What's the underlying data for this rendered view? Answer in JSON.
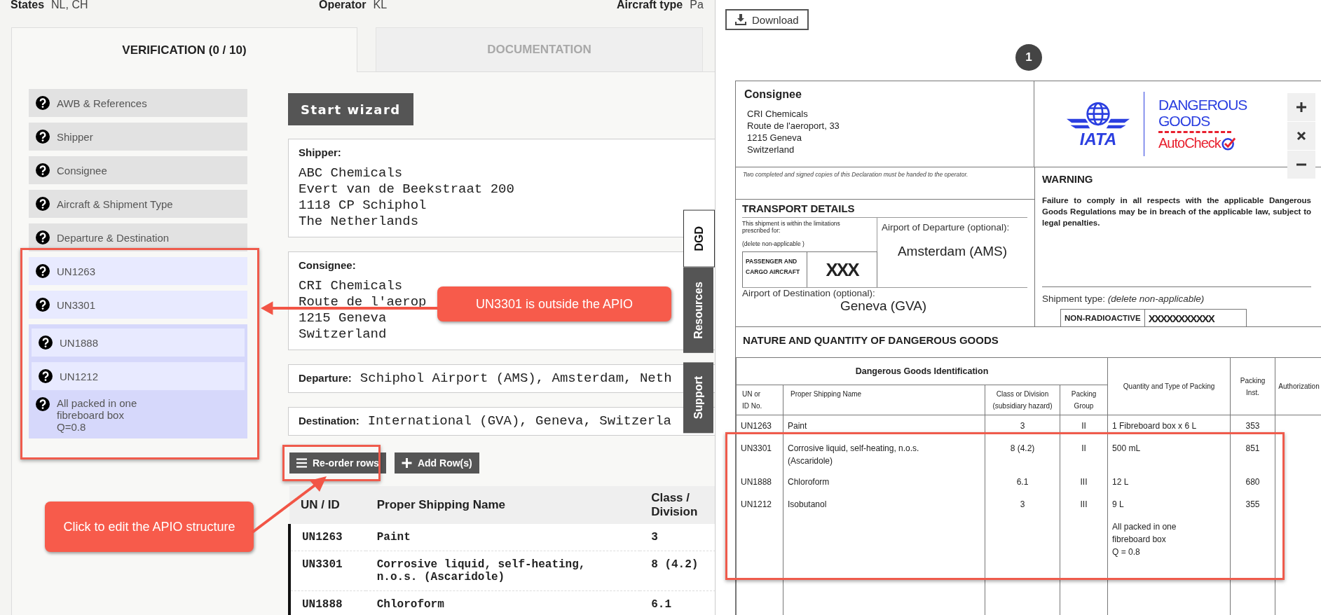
{
  "info_bar": [
    {
      "label": "States",
      "value": "NL, CH"
    },
    {
      "label": "Operator",
      "value": "KL"
    },
    {
      "label": "Aircraft type",
      "value": "Pa"
    }
  ],
  "tabs": [
    {
      "label": "VERIFICATION (0 / 10)",
      "selected": true
    },
    {
      "label": "DOCUMENTATION",
      "selected": false
    }
  ],
  "sidebar": {
    "items": [
      {
        "label": "AWB & References",
        "kind": "section"
      },
      {
        "label": "Shipper",
        "kind": "section"
      },
      {
        "label": "Consignee",
        "kind": "section"
      },
      {
        "label": "Aircraft & Shipment Type",
        "kind": "section"
      },
      {
        "label": "Departure & Destination",
        "kind": "section"
      },
      {
        "label": "UN1263",
        "kind": "apio"
      },
      {
        "label": "UN3301",
        "kind": "apio"
      },
      {
        "label": "All packed in one\nfibreboard box\nQ=0.8",
        "kind": "group",
        "children": [
          {
            "label": "UN1888",
            "kind": "apio"
          },
          {
            "label": "UN1212",
            "kind": "apio"
          }
        ]
      }
    ]
  },
  "wizard_button": "Start wizard",
  "shipper": {
    "label": "Shipper:",
    "lines": [
      "ABC Chemicals",
      "Evert van de Beekstraat 200",
      "1118 CP Schiphol",
      "The Netherlands"
    ]
  },
  "consignee": {
    "label": "Consignee:",
    "lines": [
      "CRI Chemicals",
      "Route de l'aerop",
      "1215 Geneva",
      "Switzerland"
    ]
  },
  "departure": {
    "label": "Departure:",
    "value": "Schiphol Airport (AMS), Amsterdam, Neth"
  },
  "destination": {
    "label": "Destination:",
    "value": "International (GVA), Geneva, Switzerla"
  },
  "row_buttons": [
    {
      "label": "Re-order rows",
      "kind": "reorder"
    },
    {
      "label": "Add Row(s)",
      "kind": "add"
    }
  ],
  "table": {
    "columns": [
      "UN / ID",
      "Proper Shipping Name",
      "Class /\nDivision"
    ],
    "rows": [
      [
        "UN1263",
        "Paint",
        "3"
      ],
      [
        "UN3301",
        "Corrosive liquid, self-heating,\nn.o.s. (Ascaridole)",
        "8 (4.2)"
      ],
      [
        "UN1888",
        "Chloroform",
        "6.1"
      ]
    ]
  },
  "side_tabs": [
    {
      "label": "DGD",
      "selected": true
    },
    {
      "label": "Resources",
      "selected": false
    },
    {
      "label": "Support",
      "selected": false
    }
  ],
  "callouts": [
    "UN3301 is outside the APIO",
    "Click to edit the APIO structure"
  ],
  "document": {
    "download_button": "Download",
    "page_number": "1",
    "consignee": {
      "title": "Consignee",
      "lines": [
        "CRI Chemicals",
        "Route de l'aeroport, 33",
        "1215 Geneva",
        "Switzerland"
      ]
    },
    "logo": {
      "mark": "IATA",
      "line1": "DANGEROUS",
      "line2": "GOODS",
      "brand": "AutoCheck"
    },
    "notice": "Two completed and signed copies of this Declaration must be handed to the operator.",
    "transport": {
      "title": "TRANSPORT DETAILS",
      "limitations": "This shipment is within the limitations prescribed for:",
      "delete_note": "(delete non-applicable )",
      "options": [
        {
          "label": "PASSENGER AND CARGO AIRCRAFT",
          "kind": "option"
        },
        {
          "label": "XXX",
          "kind": "strike"
        }
      ],
      "departure_label": "Airport of Departure (optional):",
      "departure": "Amsterdam (AMS)",
      "destination_label": "Airport of Destination (optional):",
      "destination": "Geneva (GVA)"
    },
    "warning": {
      "title": "WARNING",
      "text": "Failure to comply in all respects with the applicable Dangerous Goods Regulations may be in breach of the applicable law, subject to legal penalties."
    },
    "shipment_type": {
      "label": "Shipment type: *(delete non-applicable)*",
      "options": [
        {
          "label": "NON-RADIOACTIVE",
          "kind": "option"
        },
        {
          "label": "XXXXXXXXXXX",
          "kind": "strike"
        }
      ]
    },
    "section_title": "NATURE AND QUANTITY OF DANGEROUS GOODS",
    "table": {
      "group_header": "Dangerous Goods Identification",
      "columns": [
        "UN or\nID No.",
        "Proper Shipping Name",
        "Class or Division\n(subsidiary hazard)",
        "Packing\nGroup",
        "Quantity and Type of Packing",
        "Packing\nInst.",
        "Authorization"
      ],
      "rows": [
        {
          "un": "UN1263",
          "name": "Paint",
          "cls": "3",
          "pg": "II",
          "qty": "1 Fibreboard box x 6 L",
          "pi": "353"
        },
        {
          "un": "UN3301",
          "name": "Corrosive liquid, self-heating, n.o.s.\n(Ascaridole)",
          "cls": "8 (4.2)",
          "pg": "II",
          "qty": "500 mL",
          "pi": "851"
        },
        {
          "un": "UN1888",
          "name": "Chloroform",
          "cls": "6.1",
          "pg": "III",
          "qty": "12 L",
          "pi": "680"
        },
        {
          "un": "UN1212",
          "name": "Isobutanol",
          "cls": "3",
          "pg": "III",
          "qty": "9 L",
          "pi": "355"
        },
        {
          "qty": "All packed in one\nfibreboard box\nQ = 0.8"
        }
      ]
    }
  }
}
